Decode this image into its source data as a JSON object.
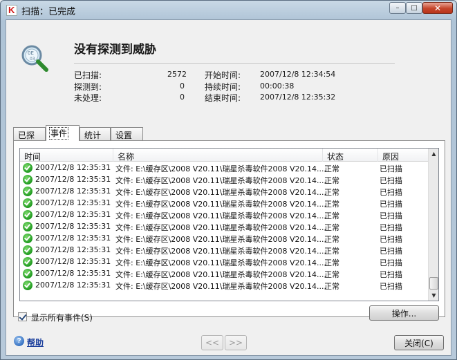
{
  "window": {
    "title": "扫描：已完成",
    "min_glyph": "–",
    "max_glyph": "□",
    "close_glyph": "✕"
  },
  "header": {
    "status_title": "没有探测到威胁",
    "stats": [
      {
        "label": "已扫描:",
        "value": "2572"
      },
      {
        "label": "探测到:",
        "value": "0"
      },
      {
        "label": "未处理:",
        "value": "0"
      }
    ],
    "times": [
      {
        "label": "开始时间:",
        "value": "2007/12/8 12:34:54"
      },
      {
        "label": "持续时间:",
        "value": "00:00:38"
      },
      {
        "label": "结束时间:",
        "value": "2007/12/8 12:35:32"
      }
    ]
  },
  "tabs": [
    "已探测",
    "事件",
    "统计",
    "设置"
  ],
  "active_tab": "事件",
  "events_table": {
    "columns": [
      "时间",
      "名称",
      "状态",
      "原因"
    ],
    "rows": [
      {
        "time": "2007/12/8 12:35:31",
        "name": "文件: E:\\缓存区\\2008 V20.11\\瑞星杀毒软件2008 V20.14....",
        "status": "正常",
        "reason": "已扫描"
      },
      {
        "time": "2007/12/8 12:35:31",
        "name": "文件: E:\\缓存区\\2008 V20.11\\瑞星杀毒软件2008 V20.14....",
        "status": "正常",
        "reason": "已扫描"
      },
      {
        "time": "2007/12/8 12:35:31",
        "name": "文件: E:\\缓存区\\2008 V20.11\\瑞星杀毒软件2008 V20.14....",
        "status": "正常",
        "reason": "已扫描"
      },
      {
        "time": "2007/12/8 12:35:31",
        "name": "文件: E:\\缓存区\\2008 V20.11\\瑞星杀毒软件2008 V20.14....",
        "status": "正常",
        "reason": "已扫描"
      },
      {
        "time": "2007/12/8 12:35:31",
        "name": "文件: E:\\缓存区\\2008 V20.11\\瑞星杀毒软件2008 V20.14....",
        "status": "正常",
        "reason": "已扫描"
      },
      {
        "time": "2007/12/8 12:35:31",
        "name": "文件: E:\\缓存区\\2008 V20.11\\瑞星杀毒软件2008 V20.14....",
        "status": "正常",
        "reason": "已扫描"
      },
      {
        "time": "2007/12/8 12:35:31",
        "name": "文件: E:\\缓存区\\2008 V20.11\\瑞星杀毒软件2008 V20.14....",
        "status": "正常",
        "reason": "已扫描"
      },
      {
        "time": "2007/12/8 12:35:31",
        "name": "文件: E:\\缓存区\\2008 V20.11\\瑞星杀毒软件2008 V20.14....",
        "status": "正常",
        "reason": "已扫描"
      },
      {
        "time": "2007/12/8 12:35:31",
        "name": "文件: E:\\缓存区\\2008 V20.11\\瑞星杀毒软件2008 V20.14....",
        "status": "正常",
        "reason": "已扫描"
      },
      {
        "time": "2007/12/8 12:35:31",
        "name": "文件: E:\\缓存区\\2008 V20.11\\瑞星杀毒软件2008 V20.14....",
        "status": "正常",
        "reason": "已扫描"
      },
      {
        "time": "2007/12/8 12:35:31",
        "name": "文件: E:\\缓存区\\2008 V20.11\\瑞星杀毒软件2008 V20.14....",
        "status": "正常",
        "reason": "已扫描"
      }
    ],
    "row_icon": "ok-check-icon"
  },
  "show_all_events": {
    "label": "显示所有事件(S)",
    "checked": true
  },
  "buttons": {
    "action": "操作...",
    "prev": "<<",
    "next": ">>",
    "close": "关闭(C)"
  },
  "help_link": "帮助",
  "colors": {
    "ok_green": "#1f9a1f",
    "link_blue": "#1b3f9c",
    "close_red": "#c5452b"
  }
}
